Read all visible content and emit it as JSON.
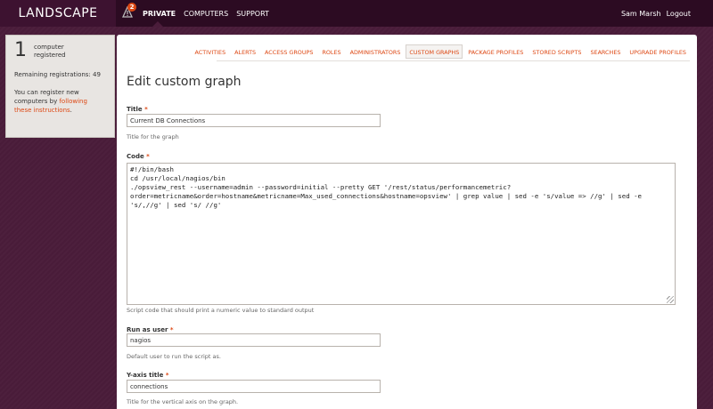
{
  "app": {
    "logo": "LANDSCAPE"
  },
  "alerts": {
    "count": "2"
  },
  "topnav": {
    "items": [
      {
        "label": "PRIVATE"
      },
      {
        "label": "COMPUTERS"
      },
      {
        "label": "SUPPORT"
      }
    ]
  },
  "user": {
    "name": "Sam Marsh",
    "logout_label": "Logout"
  },
  "sidebar": {
    "count": "1",
    "count_label": "computer registered",
    "remaining": "Remaining registrations: 49",
    "info_prefix": "You can register new computers by ",
    "info_link": "following these instructions",
    "info_suffix": "."
  },
  "subnav": {
    "tabs": [
      {
        "label": "ACTIVITIES"
      },
      {
        "label": "ALERTS"
      },
      {
        "label": "ACCESS GROUPS"
      },
      {
        "label": "ROLES"
      },
      {
        "label": "ADMINISTRATORS"
      },
      {
        "label": "CUSTOM GRAPHS"
      },
      {
        "label": "PACKAGE PROFILES"
      },
      {
        "label": "STORED SCRIPTS"
      },
      {
        "label": "SEARCHES"
      },
      {
        "label": "UPGRADE PROFILES"
      }
    ]
  },
  "form": {
    "heading": "Edit custom graph",
    "required_mark": "*",
    "title": {
      "label": "Title",
      "value": "Current DB Connections",
      "help": "Title for the graph"
    },
    "code": {
      "label": "Code",
      "value": "#!/bin/bash\ncd /usr/local/nagios/bin\n./opsview_rest --username=admin --password=initial --pretty GET '/rest/status/performancemetric?order=metricname&order=hostname&metricname=Max_used_connections&hostname=opsview' | grep value | sed -e 's/value => //g' | sed -e 's/,//g' | sed 's/ //g'",
      "help": "Script code that should print a numeric value to standard output"
    },
    "run_as": {
      "label": "Run as user",
      "value": "nagios",
      "help": "Default user to run the script as."
    },
    "y_axis": {
      "label": "Y-axis title",
      "value": "connections",
      "help": "Title for the vertical axis on the graph."
    }
  }
}
